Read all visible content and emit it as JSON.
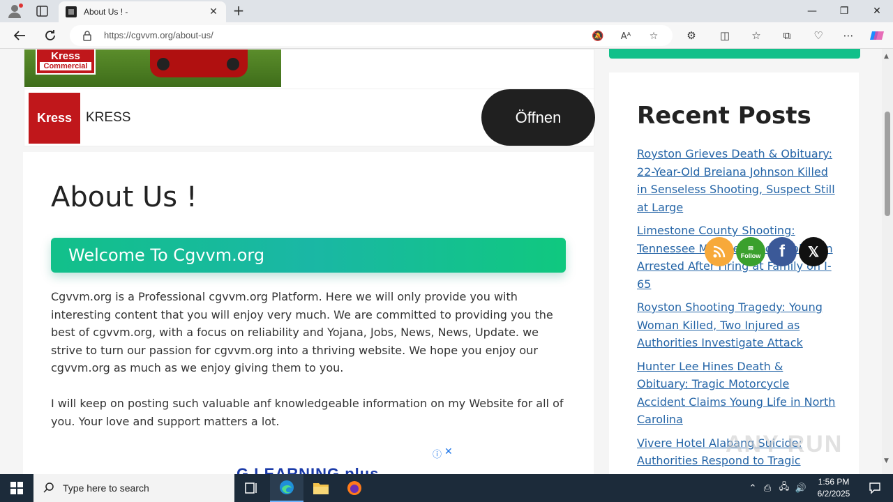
{
  "browser": {
    "tab_title": "About Us ! -",
    "url": "https://cgvvm.org/about-us/"
  },
  "ad_top": {
    "badge_name": "Kress",
    "badge_sub": "Commercial",
    "logo_text": "Kress",
    "brand": "KRESS",
    "cta": "Öffnen"
  },
  "main": {
    "title": "About Us !",
    "welcome": "Welcome To Cgvvm.org",
    "paragraph1": "Cgvvm.org is a Professional cgvvm.org Platform. Here we will only provide you with interesting content that you will enjoy very much. We are committed to providing you the best of cgvvm.org, with a focus on reliability and Yojana, Jobs, News, News, Update. we strive to turn our passion for cgvvm.org into a thriving website. We hope you enjoy our cgvvm.org as much as we enjoy giving them to you.",
    "paragraph2": "I will keep on posting such valuable anf knowledgeable information on my Website for all of you. Your love and support matters a lot."
  },
  "ad_bottom": {
    "logo": "G LEARNING plus"
  },
  "sidebar": {
    "title": "Recent Posts",
    "posts": [
      "Royston Grieves Death & Obituary: 22-Year-Old Breiana Johnson Killed in Senseless Shooting, Suspect Still at Large",
      "Limestone County Shooting: Tennessee Man Sentenced Johnson Arrested After Firing at Family on I-65",
      "Royston Shooting Tragedy: Young Woman Killed, Two Injured as Authorities Investigate Attack",
      "Hunter Lee Hines Death & Obituary: Tragic Motorcycle Accident Claims Young Life in North Carolina",
      "Vivere Hotel Alabang Suicide: Authorities Respond to Tragic Death in Muntinlupa City, Philippines"
    ]
  },
  "social": {
    "follow": "Follow"
  },
  "watermark": "ANY RUN",
  "taskbar": {
    "search_placeholder": "Type here to search",
    "time": "1:56 PM",
    "date": "6/2/2025"
  },
  "colors": {
    "accent_green": "#12c08a",
    "link": "#2565a7",
    "kress_red": "#c0171b"
  }
}
